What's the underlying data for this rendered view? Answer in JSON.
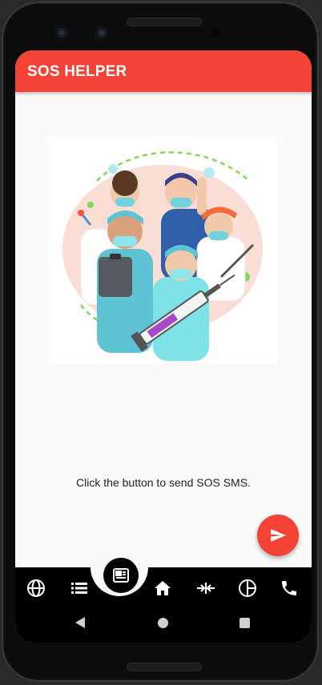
{
  "app": {
    "title": "SOS HELPER"
  },
  "main": {
    "illustration": "medical-team-illustration",
    "message": "Click the button to send SOS SMS."
  },
  "fab": {
    "icon": "send-icon"
  },
  "bottom_nav": {
    "items": [
      "globe-icon",
      "list-icon",
      "news-icon",
      "home-icon",
      "compare-arrows-icon",
      "pie-chart-icon",
      "phone-icon"
    ],
    "selected": "news-icon"
  },
  "system_nav": [
    "back",
    "home",
    "recents"
  ],
  "colors": {
    "accent": "#f44336",
    "nav_background": "#000000",
    "screen_background": "#fafafa"
  }
}
